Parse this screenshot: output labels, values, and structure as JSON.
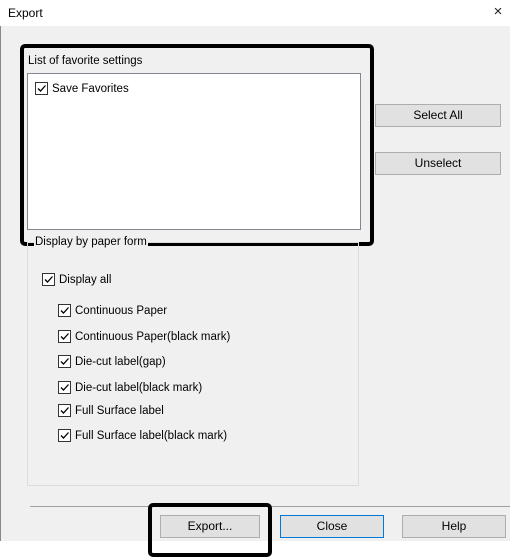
{
  "window": {
    "title": "Export",
    "close_glyph": "×"
  },
  "favorites": {
    "group_label": "List of favorite settings",
    "items": [
      {
        "label": "Save Favorites",
        "checked": true
      }
    ]
  },
  "side_buttons": {
    "select_all": "Select All",
    "unselect": "Unselect"
  },
  "paper_form": {
    "group_label": "Display by paper form",
    "display_all": {
      "label": "Display all",
      "checked": true
    },
    "items": [
      {
        "label": "Continuous Paper",
        "checked": true
      },
      {
        "label": "Continuous Paper(black mark)",
        "checked": true
      },
      {
        "label": "Die-cut label(gap)",
        "checked": true
      },
      {
        "label": "Die-cut label(black mark)",
        "checked": true
      },
      {
        "label": "Full Surface label",
        "checked": true
      },
      {
        "label": "Full Surface label(black mark)",
        "checked": true
      }
    ]
  },
  "footer_buttons": {
    "export": "Export...",
    "close": "Close",
    "help": "Help"
  },
  "icons": {
    "checkmark": "checkmark-icon",
    "close": "close-icon"
  },
  "colors": {
    "dialog_bg": "#f0f0f0",
    "default_button_border": "#0078d7",
    "highlight": "#000000"
  }
}
